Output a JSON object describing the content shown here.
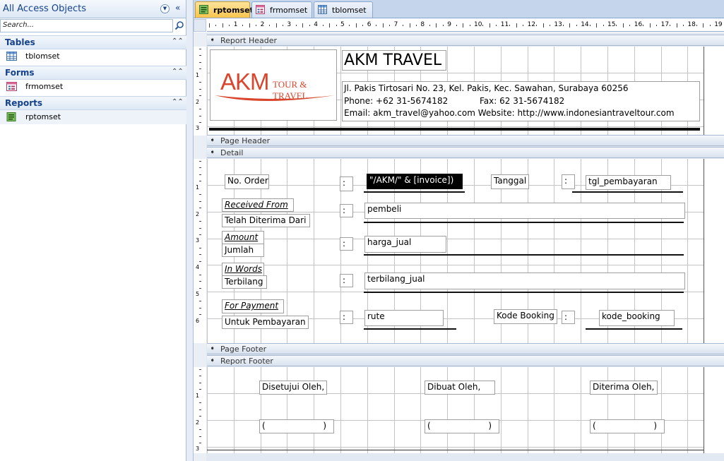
{
  "nav": {
    "title": "All Access Objects",
    "search_placeholder": "Search...",
    "groups": [
      {
        "label": "Tables",
        "items": [
          {
            "label": "tblomset",
            "icon": "table-icon"
          }
        ]
      },
      {
        "label": "Forms",
        "items": [
          {
            "label": "frmomset",
            "icon": "form-icon"
          }
        ]
      },
      {
        "label": "Reports",
        "items": [
          {
            "label": "rptomset",
            "icon": "report-icon"
          }
        ]
      }
    ]
  },
  "tabs": [
    {
      "label": "rptomset",
      "icon": "report-icon",
      "active": true
    },
    {
      "label": "frmomset",
      "icon": "form-icon",
      "active": false
    },
    {
      "label": "tblomset",
      "icon": "table-icon",
      "active": false
    }
  ],
  "ruler": {
    "numbers": [
      "1",
      "2",
      "3",
      "4",
      "5",
      "6",
      "7",
      "8",
      "9",
      "10",
      "11",
      "12",
      "13",
      "14",
      "15",
      "16",
      "17",
      "18",
      "19"
    ]
  },
  "sections": {
    "report_header": "Report Header",
    "page_header": "Page Header",
    "detail": "Detail",
    "page_footer": "Page Footer",
    "report_footer": "Report Footer"
  },
  "header": {
    "logo_text": "AKM",
    "logo_sub": "TOUR & TRAVEL",
    "company": "AKM TRAVEL",
    "address": "Jl. Pakis Tirtosari No. 23, Kel. Pakis, Kec. Sawahan, Surabaya 60256",
    "phone": "Phone: +62 31-5674182",
    "fax": "Fax: 62 31-5674182",
    "contact": "Email: akm_travel@yahoo.com Website: http://www.indonesiantraveltour.com"
  },
  "detail": {
    "no_order": "No. Order",
    "colon": ":",
    "invoice_expr": "\"/AKM/\" & [invoice])",
    "tanggal": "Tanggal",
    "tgl_field": "tgl_pembayaran",
    "received_from": "Received From",
    "telah_diterima": "Telah Diterima Dari",
    "pembeli": "pembeli",
    "amount": "Amount",
    "jumlah": "Jumlah",
    "harga_jual": "harga_jual",
    "in_words": "In Words",
    "terbilang": "Terbilang",
    "terbilang_jual": "terbilang_jual",
    "for_payment": "For Payment",
    "untuk_pembayaran": "Untuk Pembayaran",
    "rute": "rute",
    "kode_booking_label": "Kode Booking",
    "kode_booking": "kode_booking"
  },
  "footer": {
    "disetujui": "Disetujui Oleh,",
    "dibuat": "Dibuat Oleh,",
    "diterima": "Diterima Oleh,",
    "sig_open": "(",
    "sig_close": ")"
  },
  "colors": {
    "logo_red": "#d9462d",
    "active_tab": "#f9c44e",
    "nav_header": "#15428b"
  }
}
